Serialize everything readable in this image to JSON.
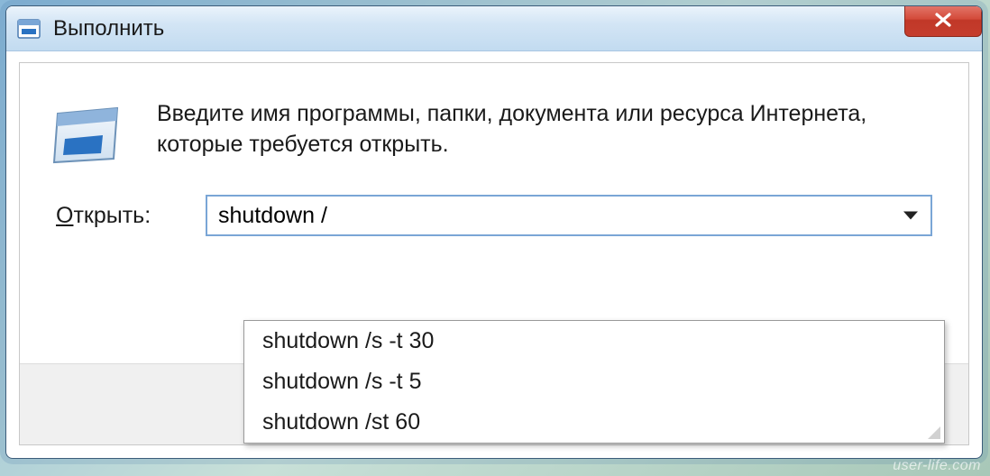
{
  "window": {
    "title": "Выполнить"
  },
  "description": "Введите имя программы, папки, документа или ресурса Интернета, которые требуется открыть.",
  "field": {
    "label_prefix": "О",
    "label_rest": "ткрыть:",
    "value": "shutdown /"
  },
  "suggestions": [
    "shutdown /s -t 30",
    "shutdown /s -t 5",
    "shutdown /st 60"
  ],
  "watermark": "user-life.com"
}
